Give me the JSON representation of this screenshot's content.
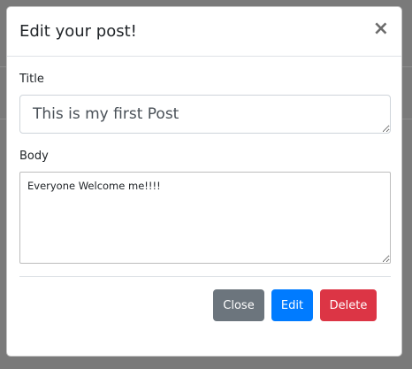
{
  "modal": {
    "title": "Edit your post!",
    "close_symbol": "×",
    "fields": {
      "title_label": "Title",
      "title_value": "This is my first Post",
      "body_label": "Body",
      "body_value": "Everyone Welcome me!!!!"
    },
    "buttons": {
      "close_label": "Close",
      "edit_label": "Edit",
      "delete_label": "Delete"
    }
  },
  "colors": {
    "close_button": "#6c757d",
    "edit_button": "#007bff",
    "delete_button": "#dc3545",
    "backdrop": "#7a7a7a"
  }
}
